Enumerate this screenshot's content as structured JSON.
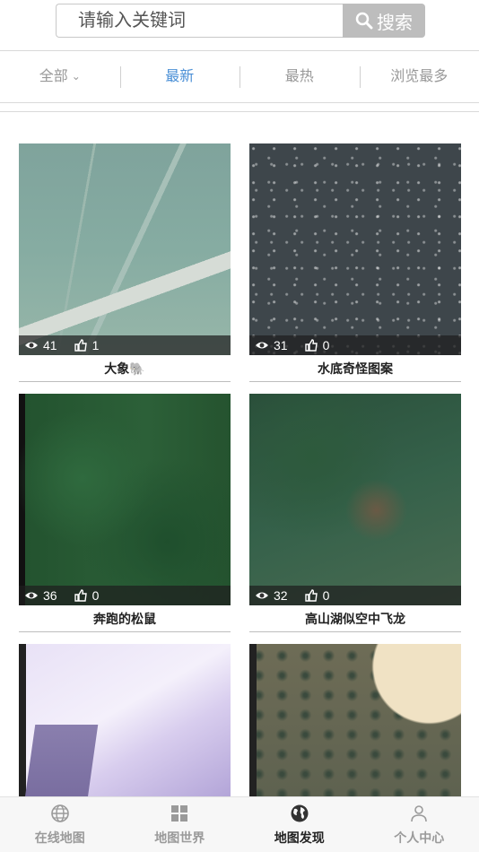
{
  "search": {
    "placeholder": "请输入关键词",
    "button_label": "搜索"
  },
  "filters": [
    {
      "label": "全部",
      "icon": "chevron-down-icon",
      "active": false
    },
    {
      "label": "最新",
      "active": true
    },
    {
      "label": "最热",
      "active": false
    },
    {
      "label": "浏览最多",
      "active": false
    }
  ],
  "colors": {
    "accent": "#4a8fd6",
    "search_button": "#bdbdbd"
  },
  "cards": [
    {
      "title": "大象🐘",
      "views": "41",
      "likes": "1"
    },
    {
      "title": "水底奇怪图案",
      "views": "31",
      "likes": "0"
    },
    {
      "title": "奔跑的松鼠",
      "views": "36",
      "likes": "0"
    },
    {
      "title": "高山湖似空中飞龙",
      "views": "32",
      "likes": "0"
    },
    {
      "title": "",
      "views": "",
      "likes": ""
    },
    {
      "title": "",
      "views": "",
      "likes": ""
    }
  ],
  "bottom_nav": [
    {
      "label": "在线地图",
      "icon": "globe-icon",
      "active": false
    },
    {
      "label": "地图世界",
      "icon": "grid-icon",
      "active": false
    },
    {
      "label": "地图发现",
      "icon": "earth-icon",
      "active": true
    },
    {
      "label": "个人中心",
      "icon": "user-icon",
      "active": false
    }
  ]
}
